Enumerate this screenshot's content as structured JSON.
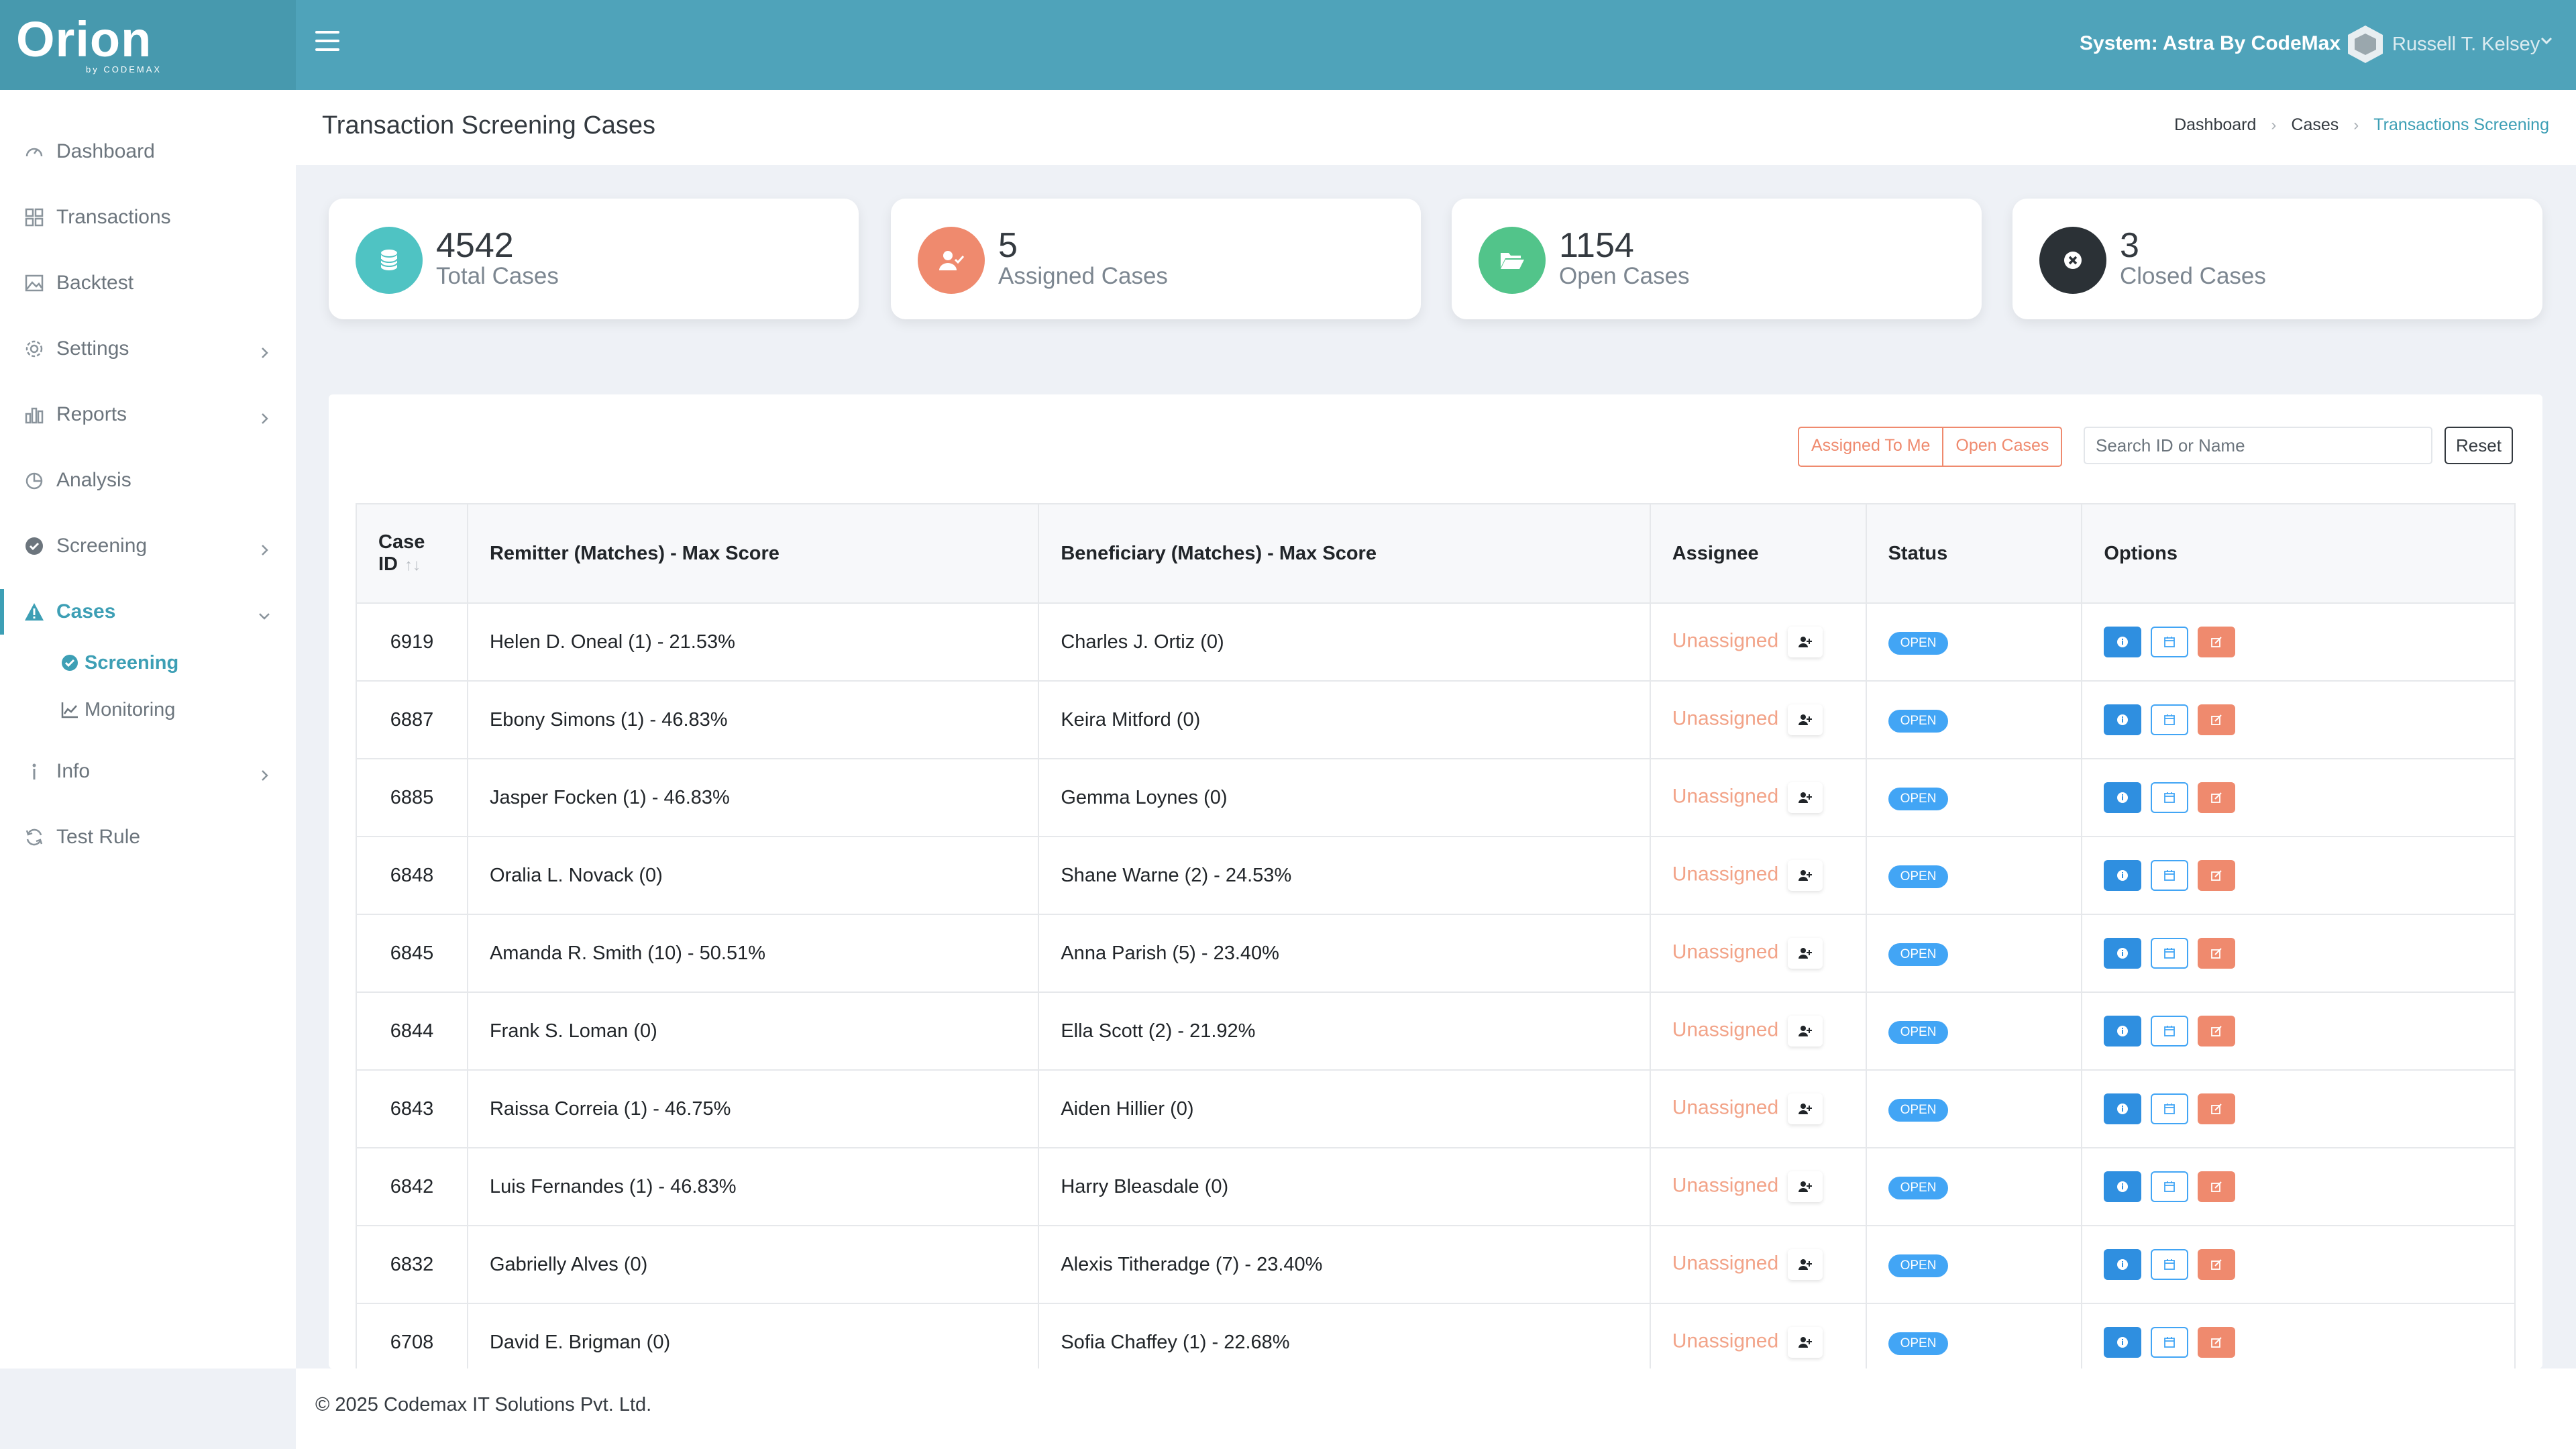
{
  "app": {
    "logo": "Orion",
    "logo_sub": "by CODEMAX",
    "system_label": "System: Astra By CodeMax",
    "user_name": "Russell T. Kelsey"
  },
  "sidebar": {
    "items": [
      {
        "label": "Dashboard",
        "icon": "gauge-icon"
      },
      {
        "label": "Transactions",
        "icon": "grid-icon"
      },
      {
        "label": "Backtest",
        "icon": "image-icon"
      },
      {
        "label": "Settings",
        "icon": "gear-icon"
      },
      {
        "label": "Reports",
        "icon": "bar-chart-icon"
      },
      {
        "label": "Analysis",
        "icon": "pie-icon"
      },
      {
        "label": "Screening",
        "icon": "check-circle-icon"
      },
      {
        "label": "Cases",
        "icon": "warning-icon"
      },
      {
        "label": "Info",
        "icon": "info-icon"
      },
      {
        "label": "Test Rule",
        "icon": "refresh-icon"
      }
    ],
    "subitems": [
      {
        "label": "Screening",
        "icon": "check-circle-icon"
      },
      {
        "label": "Monitoring",
        "icon": "line-chart-icon"
      }
    ]
  },
  "page": {
    "title": "Transaction Screening Cases",
    "breadcrumbs": [
      "Dashboard",
      "Cases",
      "Transactions Screening"
    ]
  },
  "stats": [
    {
      "value": "4542",
      "label": "Total Cases",
      "color": "#4fc3c3"
    },
    {
      "value": "5",
      "label": "Assigned Cases",
      "color": "#ef8a6e"
    },
    {
      "value": "1154",
      "label": "Open Cases",
      "color": "#52c48a"
    },
    {
      "value": "3",
      "label": "Closed Cases",
      "color": "#2b3136"
    }
  ],
  "filters": {
    "assigned_to_me": "Assigned To Me",
    "open_cases": "Open Cases",
    "search_placeholder": "Search ID or Name",
    "reset": "Reset"
  },
  "table": {
    "headers": {
      "case_id_1": "Case",
      "case_id_2": "ID",
      "remitter": "Remitter (Matches) - Max Score",
      "beneficiary": "Beneficiary (Matches) - Max Score",
      "assignee": "Assignee",
      "status": "Status",
      "options": "Options"
    },
    "rows": [
      {
        "id": "6919",
        "remitter": "Helen D. Oneal (1) - 21.53%",
        "beneficiary": "Charles J. Ortiz (0)",
        "assignee": "Unassigned",
        "status": "OPEN"
      },
      {
        "id": "6887",
        "remitter": "Ebony Simons (1) - 46.83%",
        "beneficiary": "Keira Mitford (0)",
        "assignee": "Unassigned",
        "status": "OPEN"
      },
      {
        "id": "6885",
        "remitter": "Jasper Focken (1) - 46.83%",
        "beneficiary": "Gemma Loynes (0)",
        "assignee": "Unassigned",
        "status": "OPEN"
      },
      {
        "id": "6848",
        "remitter": "Oralia L. Novack (0)",
        "beneficiary": "Shane Warne (2) - 24.53%",
        "assignee": "Unassigned",
        "status": "OPEN"
      },
      {
        "id": "6845",
        "remitter": "Amanda R. Smith (10) - 50.51%",
        "beneficiary": "Anna Parish (5) - 23.40%",
        "assignee": "Unassigned",
        "status": "OPEN"
      },
      {
        "id": "6844",
        "remitter": "Frank S. Loman (0)",
        "beneficiary": "Ella Scott (2) - 21.92%",
        "assignee": "Unassigned",
        "status": "OPEN"
      },
      {
        "id": "6843",
        "remitter": "Raissa Correia (1) - 46.75%",
        "beneficiary": "Aiden Hillier (0)",
        "assignee": "Unassigned",
        "status": "OPEN"
      },
      {
        "id": "6842",
        "remitter": "Luis Fernandes (1) - 46.83%",
        "beneficiary": "Harry Bleasdale (0)",
        "assignee": "Unassigned",
        "status": "OPEN"
      },
      {
        "id": "6832",
        "remitter": "Gabrielly Alves (0)",
        "beneficiary": "Alexis Titheradge (7) - 23.40%",
        "assignee": "Unassigned",
        "status": "OPEN"
      },
      {
        "id": "6708",
        "remitter": "David E. Brigman (0)",
        "beneficiary": "Sofia Chaffey (1) - 22.68%",
        "assignee": "Unassigned",
        "status": "OPEN"
      }
    ]
  },
  "footer": {
    "text": "© 2025 Codemax IT Solutions Pvt. Ltd."
  }
}
